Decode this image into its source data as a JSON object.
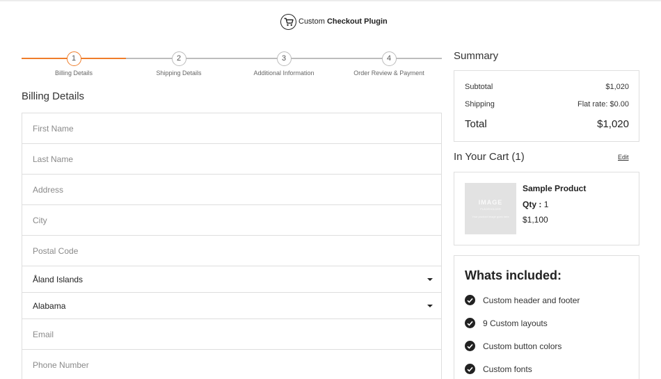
{
  "header": {
    "brand_light": "Custom",
    "brand_bold": "Checkout Plugin",
    "cart_icon": "shopping-cart-icon"
  },
  "steps": [
    {
      "number": "1",
      "label": "Billing Details",
      "active": true
    },
    {
      "number": "2",
      "label": "Shipping Details",
      "active": false
    },
    {
      "number": "3",
      "label": "Additional Information",
      "active": false
    },
    {
      "number": "4",
      "label": "Order Review & Payment",
      "active": false
    }
  ],
  "colors": {
    "accent": "#ef7d2a",
    "border": "#dedede"
  },
  "billing": {
    "title": "Billing Details",
    "first_name_placeholder": "First Name",
    "last_name_placeholder": "Last Name",
    "address_placeholder": "Address",
    "city_placeholder": "City",
    "postal_code_placeholder": "Postal Code",
    "country_value": "Åland Islands",
    "state_value": "Alabama",
    "email_placeholder": "Email",
    "phone_placeholder": "Phone Number"
  },
  "summary": {
    "title": "Summary",
    "subtotal_label": "Subtotal",
    "subtotal_value": "$1,020",
    "shipping_label": "Shipping",
    "shipping_value": "Flat rate: $0.00",
    "total_label": "Total",
    "total_value": "$1,020"
  },
  "cart": {
    "title": "In Your Cart (1)",
    "edit_label": "Edit",
    "product": {
      "image_text": "IMAGE",
      "image_sub": "PLACEHOLDER",
      "image_note": "Your product image goes here",
      "name": "Sample Product",
      "qty_label": "Qty :",
      "qty_value": "1",
      "price": "$1,100"
    }
  },
  "included": {
    "title": "Whats included:",
    "items": [
      "Custom header and footer",
      "9 Custom layouts",
      "Custom button colors",
      "Custom fonts"
    ]
  }
}
